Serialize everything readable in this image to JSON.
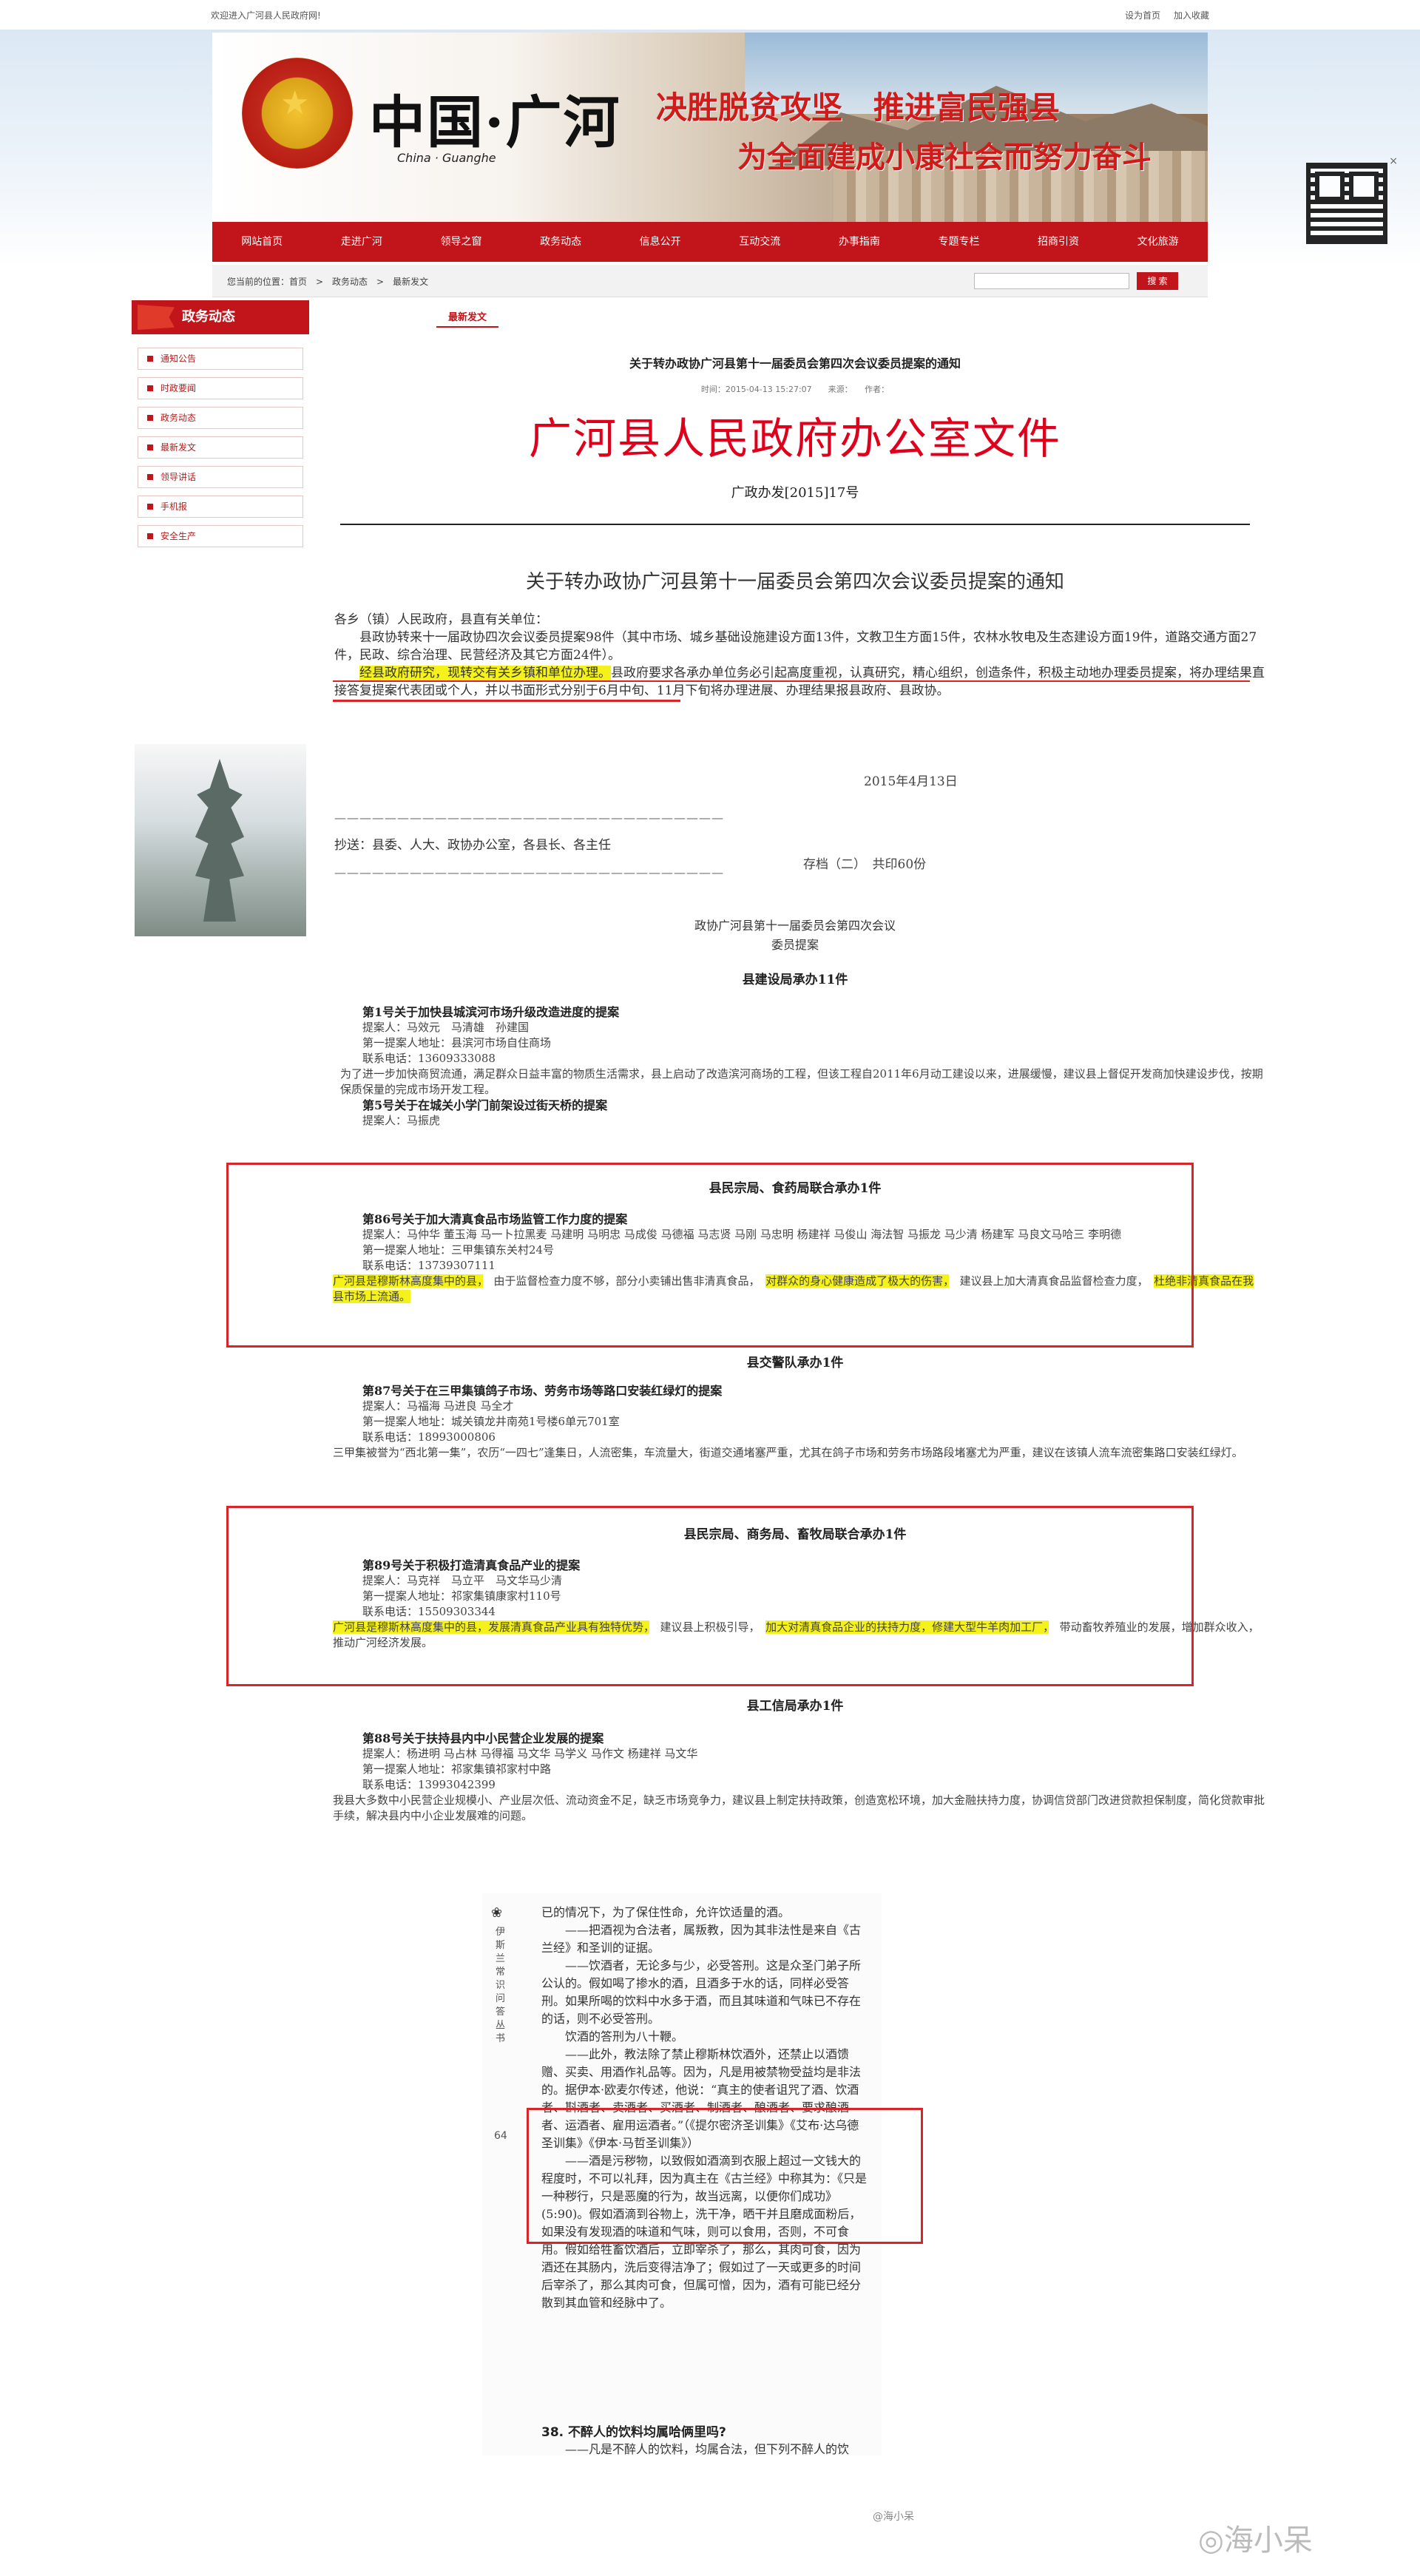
{
  "topbar": {
    "welcome": "欢迎进入广河县人民政府网!",
    "set_home": "设为首页",
    "add_favorite": "加入收藏"
  },
  "banner": {
    "logo_cn": "中国·广河",
    "logo_en": "China · Guanghe",
    "slogan1": "决胜脱贫攻坚　推进富民强县",
    "slogan2": "为全面建成小康社会而努力奋斗",
    "colors": {
      "brand_red": "#c2151b",
      "slogan_red": "#d11a1a"
    }
  },
  "nav": {
    "items": [
      "网站首页",
      "走进广河",
      "领导之窗",
      "政务动态",
      "信息公开",
      "互动交流",
      "办事指南",
      "专题专栏",
      "招商引资",
      "文化旅游"
    ]
  },
  "crumbbar": {
    "crumb": "您当前的位置：首页　>　政务动态　>　最新发文",
    "search_button": "搜 索"
  },
  "sidebar": {
    "title": "政务动态",
    "items": [
      "通知公告",
      "时政要闻",
      "政务动态",
      "最新发文",
      "领导讲话",
      "手机报",
      "安全生产"
    ]
  },
  "article": {
    "tab": "最新发文",
    "title": "关于转办政协广河县第十一届委员会第四次会议委员提案的通知",
    "meta": "时间：2015-04-13 15:27:07　　来源：　　作者：",
    "red_header": "广河县人民政府办公室文件",
    "doc_no": "广政办发[2015]17号",
    "subject": "关于转办政协广河县第十一届委员会第四次会议委员提案的通知",
    "salutation": "各乡（镇）人民政府，县直有关单位：",
    "para1": "县政协转来十一届政协四次会议委员提案98件（其中市场、城乡基础设施建设方面13件，文教卫生方面15件，农林水牧电及生态建设方面19件，道路交通方面27件，民政、综合治理、民营经济及其它方面24件）。",
    "para2_hl": "经县政府研究，现转交有关乡镇和单位办理。",
    "para2_rest": "县政府要求各承办单位务必引起高度重视，认真研究，精心组织，创造条件，积极主动地办理委员提案，将办理结果直接答复提案代表团或个人，并以书面形式分别于6月中旬、11月下旬将办理进展、办理结果报县政府、县政协。",
    "date": "2015年4月13日",
    "dash": "———————————————————————————————",
    "cc": "抄送：县委、人大、政协办公室，各县长、各主任",
    "archive": "存档（二）　共印60份",
    "prop_head1": "政协广河县第十一届委员会第四次会议",
    "prop_head2": "委员提案",
    "section1": "县建设局承办11件",
    "p1_title": "第1号关于加快县城滨河市场升级改造进度的提案",
    "p1_people": "提案人：马效元　马清雄　孙建国",
    "p1_addr": "第一提案人地址：县滨河市场自住商场",
    "p1_phone": "联系电话：13609333088",
    "p1_body": "为了进一步加快商贸流通，满足群众日益丰富的物质生活需求，县上启动了改造滨河商场的工程，但该工程自2011年6月动工建设以来，进展缓慢，建议县上督促开发商加快建设步伐，按期保质保量的完成市场开发工程。",
    "p5_title": "第5号关于在城关小学门前架设过街天桥的提案",
    "p5_people": "提案人：马振虎",
    "section2": "县民宗局、食药局联合承办1件",
    "p86_title": "第86号关于加大清真食品市场监管工作力度的提案",
    "p86_people": "提案人：马仲华 董玉海 马一卜拉黑麦 马建明 马明忠 马成俊 马德福 马志贤 马刚 马忠明 杨建祥 马俊山 海法智 马振龙 马少清 杨建军 马良文马哈三 李明德",
    "p86_addr": "第一提案人地址：三甲集镇东关村24号",
    "p86_phone": "联系电话：13739307111",
    "p86_hl1": "广河县是穆斯林高度集中的县，",
    "p86_mid1": "由于监督检查力度不够，部分小卖铺出售非清真食品，",
    "p86_hl2": "对群众的身心健康造成了极大的伤害，",
    "p86_mid2": "建议县上加大清真食品监督检查力度，",
    "p86_hl3": "杜绝非清真食品在我县市场上流通。",
    "section3": "县交警队承办1件",
    "p87_title": "第87号关于在三甲集镇鸽子市场、劳务市场等路口安装红绿灯的提案",
    "p87_people": "提案人：马福海 马进良 马全才",
    "p87_addr": "第一提案人地址：城关镇龙井南苑1号楼6单元701室",
    "p87_phone": "联系电话：18993000806",
    "p87_body": "三甲集被誉为“西北第一集”，农历“一四七”逢集日，人流密集，车流量大，街道交通堵塞严重，尤其在鸽子市场和劳务市场路段堵塞尤为严重，建议在该镇人流车流密集路口安装红绿灯。",
    "section4": "县民宗局、商务局、畜牧局联合承办1件",
    "p89_title": "第89号关于积极打造清真食品产业的提案",
    "p89_people": "提案人：马克祥　马立平　马文华马少清",
    "p89_addr": "第一提案人地址：祁家集镇康家村110号",
    "p89_phone": "联系电话：15509303344",
    "p89_hl1": "广河县是穆斯林高度集中的县，发展清真食品产业具有独特优势，",
    "p89_mid": "建议县上积极引导，",
    "p89_hl2": "加大对清真食品企业的扶持力度，修建大型牛羊肉加工厂，",
    "p89_rest": "带动畜牧养殖业的发展，增加群众收入，推动广河经济发展。",
    "section5": "县工信局承办1件",
    "p88_title": "第88号关于扶持县内中小民营企业发展的提案",
    "p88_people": "提案人：杨进明 马占林 马得福 马文华 马学义 马作文 杨建祥 马文华",
    "p88_addr": "第一提案人地址：祁家集镇祁家村中路",
    "p88_phone": "联系电话：13993042399",
    "p88_body": "我县大多数中小民营企业规模小、产业层次低、流动资金不足，缺乏市场竞争力，建议县上制定扶持政策，创造宽松环境，加大金融扶持力度，协调信贷部门改进贷款担保制度，简化贷款审批手续，解决县内中小企业发展难的问题。"
  },
  "book": {
    "ornament": "❀",
    "spine": "伊斯兰常识问答丛书",
    "page_no": "64",
    "line1": "已的情况下，为了保住性命，允许饮适量的酒。",
    "para1": "——把酒视为合法者，属叛教，因为其非法性是来自《古兰经》和圣训的证据。",
    "para2": "——饮酒者，无论多与少，必受答刑。这是众圣门弟子所公认的。假如喝了掺水的酒，且酒多于水的话，同样必受答刑。如果所喝的饮料中水多于酒，而且其味道和气味已不存在的话，则不必受答刑。",
    "para3": "饮酒的答刑为八十鞭。",
    "para4": "——此外，教法除了禁止穆斯林饮酒外，还禁止以酒馈赠、买卖、用酒作礼品等。因为，凡是用被禁物受益均是非法的。据伊本·欧麦尔传述，他说：“真主的使者诅咒了酒、饮酒者、斟酒者、卖酒者、买酒者、制酒者、酿酒者、要求酿酒者、运酒者、雇用运酒者。”（《提尔密济圣训集》《艾布·达乌德圣训集》《伊本·马哲圣训集》）",
    "para5": "——酒是污秽物，以致假如酒滴到衣服上超过一文钱大的程度时，不可以礼拜，因为真主在《古兰经》中称其为：《只是一种秽行，只是恶魔的行为，故当远离，以便你们成功》(5:90)。假如酒滴到谷物上，洗干净，晒干并且磨成面粉后，如果没有发现酒的味道和气味，则可以食用，否则，不可食用。假如给牲畜饮酒后，立即宰杀了，那么，其肉可食，因为酒还在其肠内，洗后变得洁净了；假如过了一天或更多的时间后宰杀了，那么其肉可食，但属可憎，因为，酒有可能已经分散到其血管和经脉中了。",
    "q38": "38. 不醉人的饮料均属哈俩里吗?",
    "after38": "——凡是不醉人的饮料，均属合法，但下列不醉人的饮"
  },
  "watermark": {
    "weibo": "@海小呆",
    "big": "◎海小呆"
  }
}
